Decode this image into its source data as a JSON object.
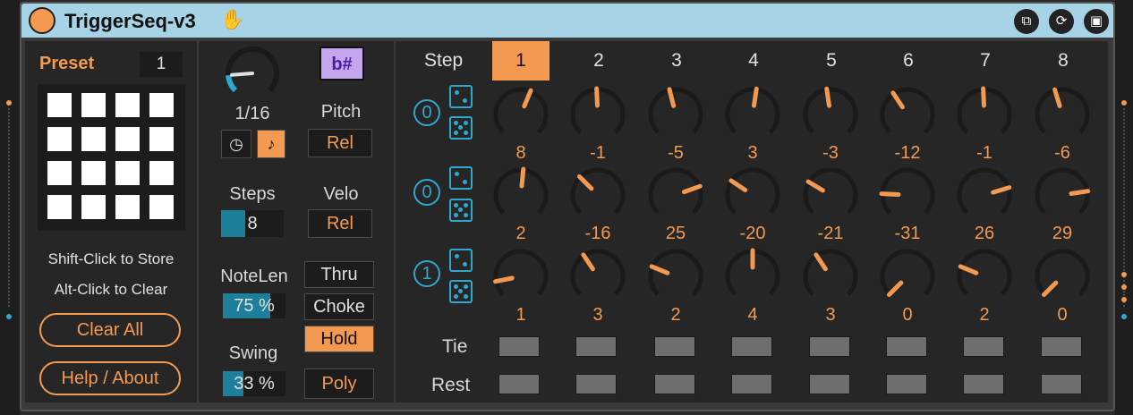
{
  "title": "TriggerSeq-v3",
  "icons": {
    "hand": "hand-icon",
    "power": "power-button",
    "pin": "pin-icon",
    "refresh": "refresh-icon",
    "save": "save-icon"
  },
  "colors": {
    "accent": "#f39a50",
    "cyan": "#2fa8cf",
    "title_bar": "#a6d3e6",
    "panel": "#262626"
  },
  "preset": {
    "label": "Preset",
    "number": "1",
    "hint_store": "Shift-Click to Store",
    "hint_clear": "Alt-Click to Clear",
    "clear_all": "Clear All",
    "help": "Help / About"
  },
  "controls": {
    "rate": "1/16",
    "rate_fraction": 0.15,
    "scale_button": "b#",
    "pitch_label": "Pitch",
    "pitch_mode": "Rel",
    "steps_label": "Steps",
    "steps_value": "8",
    "steps_fraction": 0.38,
    "velo_label": "Velo",
    "velo_mode": "Rel",
    "notelen_label": "NoteLen",
    "notelen_value": "75 %",
    "notelen_fraction": 0.75,
    "swing_label": "Swing",
    "swing_value": "33 %",
    "swing_fraction": 0.33,
    "thru": "Thru",
    "choke": "Choke",
    "hold": "Hold",
    "poly": "Poly"
  },
  "sequencer": {
    "step_label": "Step",
    "steps": [
      "1",
      "2",
      "3",
      "4",
      "5",
      "6",
      "7",
      "8"
    ],
    "active_step": "1",
    "rows": [
      {
        "circle": "0",
        "values": [
          "8",
          "-1",
          "-5",
          "3",
          "-3",
          "-12",
          "-1",
          "-6"
        ],
        "range": [
          -48,
          48
        ]
      },
      {
        "circle": "0",
        "values": [
          "2",
          "-16",
          "25",
          "-20",
          "-21",
          "-31",
          "26",
          "29"
        ],
        "range": [
          -48,
          48
        ]
      },
      {
        "circle": "1",
        "values": [
          "1",
          "3",
          "2",
          "4",
          "3",
          "0",
          "2",
          "0"
        ],
        "range": [
          0,
          8
        ]
      }
    ],
    "tie_label": "Tie",
    "rest_label": "Rest"
  }
}
